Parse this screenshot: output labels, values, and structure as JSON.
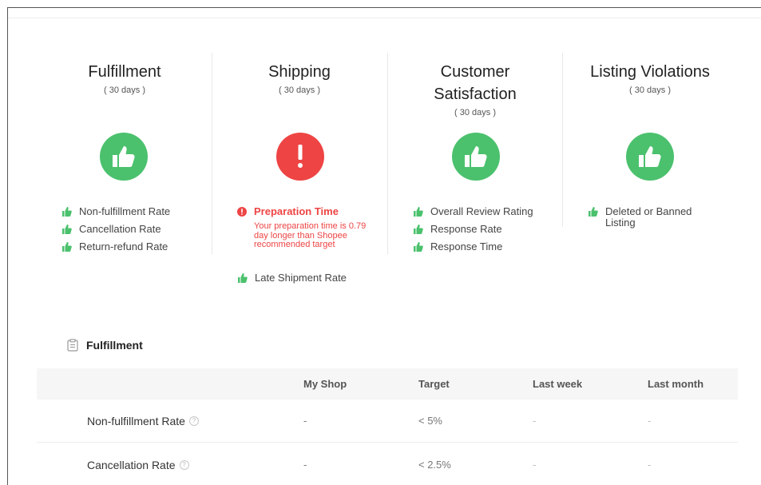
{
  "summary": {
    "columns": [
      {
        "title": "Fulfillment",
        "period": "( 30 days )",
        "status": "good",
        "metrics": [
          "Non-fulfillment Rate",
          "Cancellation Rate",
          "Return-refund Rate"
        ]
      },
      {
        "title": "Shipping",
        "period": "( 30 days )",
        "status": "bad",
        "warning": {
          "label": "Preparation Time",
          "description": "Your preparation time is 0.79 day longer than Shopee recommended target"
        },
        "metrics": [
          "Late Shipment Rate"
        ]
      },
      {
        "title_line1": "Customer",
        "title_line2": "Satisfaction",
        "period": "( 30 days )",
        "status": "good",
        "metrics": [
          "Overall Review Rating",
          "Response Rate",
          "Response Time"
        ]
      },
      {
        "title": "Listing Violations",
        "period": "( 30 days )",
        "status": "good",
        "metric_line1": "Deleted or Banned",
        "metric_line2": "Listing"
      }
    ]
  },
  "section": {
    "title": "Fulfillment",
    "icon": "clipboard-icon"
  },
  "table": {
    "headers": [
      "My Shop",
      "Target",
      "Last week",
      "Last month"
    ],
    "rows": [
      {
        "name": "Non-fulfillment Rate",
        "my_shop": "-",
        "target": "< 5%",
        "last_week": "-",
        "last_month": "-"
      },
      {
        "name": "Cancellation Rate",
        "my_shop": "-",
        "target": "< 2.5%",
        "last_week": "-",
        "last_month": "-"
      }
    ]
  },
  "colors": {
    "good": "#4bc16d",
    "bad": "#ee4444"
  }
}
